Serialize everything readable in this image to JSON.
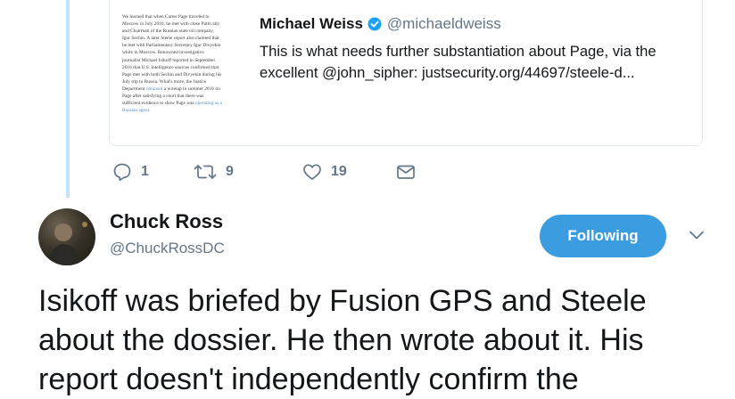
{
  "quoted_tweet": {
    "thumbnail_lines": [
      "We learned that when Carter Page traveled to",
      "Moscow in July 2016, he met with close Putin ally",
      "and Chairman of the Russian state oil company,",
      "Igor Sechin.  A later Steele report also claimed that",
      "he met with Parliamentary Secretary Igor Divyekin",
      "while in Moscow.  Renowned investigative",
      "journalist Michael Isikoff reported in September",
      "2016 that U.S. intelligence sources confirmed that",
      "Page met with both Sechin and Divyekin during his",
      "July trip to Russia. What's more, the Justice",
      "Department",
      "obtained",
      "a wiretap in summer 2016 on",
      "Page after satisfying a court that there was",
      "sufficient evidence to show Page was",
      "operating as a",
      "Russian agent."
    ],
    "author_name": "Michael Weiss",
    "author_handle": "@michaeldweiss",
    "text": "This is what needs further substantiation about Page, via the excellent @john_sipher: justsecurity.org/44697/steele-d..."
  },
  "actions": {
    "reply_count": "1",
    "retweet_count": "9",
    "like_count": "19"
  },
  "tweet": {
    "author_name": "Chuck Ross",
    "author_handle": "@ChuckRossDC",
    "follow_label": "Following",
    "text": "Isikoff was briefed by Fusion GPS and Steele about the dossier. He then wrote about it. His report doesn't independently confirm the"
  },
  "icons": {
    "verified": "verified-badge-icon",
    "reply": "reply-icon",
    "retweet": "retweet-icon",
    "like": "heart-icon",
    "dm": "envelope-icon",
    "more": "chevron-down-icon"
  },
  "colors": {
    "accent": "#1da1f2",
    "follow_button": "#3b9ce0",
    "secondary_text": "#657786",
    "thread_line": "#c4e4f8"
  }
}
